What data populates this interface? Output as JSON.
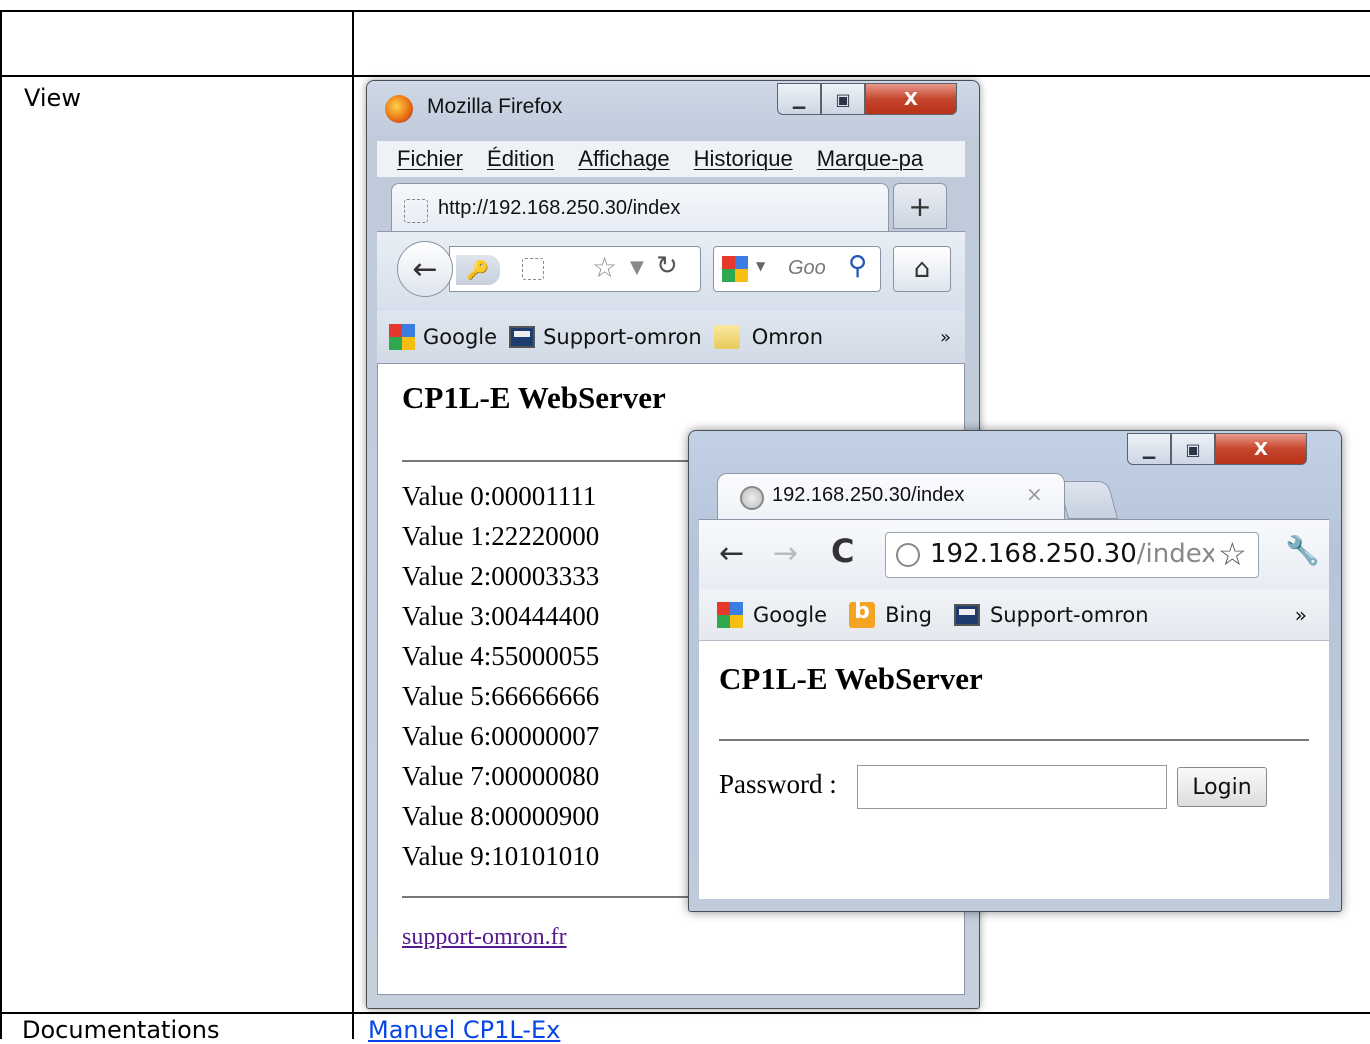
{
  "table": {
    "row_view_label": "View",
    "row_docs_label": "Documentations",
    "row_docs_link": "Manuel CP1L-Ex"
  },
  "firefox": {
    "window_title": "Mozilla Firefox",
    "menu": [
      "Fichier",
      "Édition",
      "Affichage",
      "Historique",
      "Marque-pa"
    ],
    "tab_label": "http://192.168.250.30/index",
    "new_tab": "+",
    "search_placeholder": "Goo",
    "bookmarks": [
      {
        "label": "Google",
        "icon": "google-icon"
      },
      {
        "label": "Support-omron",
        "icon": "screen-icon"
      },
      {
        "label": "Omron",
        "icon": "folder-icon"
      }
    ],
    "bookmarks_more": "»",
    "page": {
      "title": "CP1L-E WebServer",
      "values": [
        "Value 0:00001111",
        "Value 1:22220000",
        "Value 2:00003333",
        "Value 3:00444400",
        "Value 4:55000055",
        "Value 5:66666666",
        "Value 6:00000007",
        "Value 7:00000080",
        "Value 8:00000900",
        "Value 9:10101010"
      ],
      "link": "support-omron.fr"
    }
  },
  "chrome": {
    "tab_label": "192.168.250.30/index",
    "tab_close": "×",
    "url_host": "192.168.250.30",
    "url_path": "/index",
    "bookmarks": [
      {
        "label": "Google",
        "icon": "google-icon"
      },
      {
        "label": "Bing",
        "icon": "bing-icon"
      },
      {
        "label": "Support-omron",
        "icon": "screen-icon"
      }
    ],
    "bookmarks_more": "»",
    "page": {
      "title": "CP1L-E WebServer",
      "password_label": "Password :",
      "password_value": "",
      "login_label": "Login"
    }
  },
  "colors": {
    "link_blue": "#0645e8",
    "visited_link": "#551a8b",
    "close_red": "#c4452d"
  }
}
